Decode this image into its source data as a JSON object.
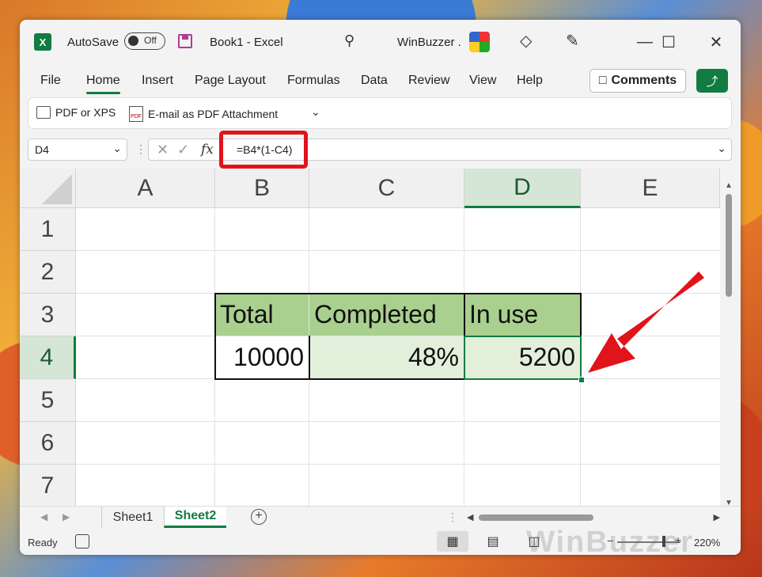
{
  "titlebar": {
    "autosave_label": "AutoSave",
    "autosave_state": "Off",
    "doc_title": "Book1  -  Excel",
    "account_name": "WinBuzzer ."
  },
  "menu": {
    "items": [
      "File",
      "Home",
      "Insert",
      "Page Layout",
      "Formulas",
      "Data",
      "Review",
      "View",
      "Help"
    ],
    "active": "Home",
    "comments_label": "Comments"
  },
  "ribbon": {
    "pdf_xps_label": "PDF or XPS",
    "email_pdf_label": "E-mail as PDF Attachment",
    "pdf_icon_text": "PDF"
  },
  "formula_bar": {
    "name_box": "D4",
    "fx_label": "fx",
    "formula": "=B4*(1-C4)"
  },
  "grid": {
    "columns": [
      "A",
      "B",
      "C",
      "D",
      "E"
    ],
    "rows": [
      "1",
      "2",
      "3",
      "4",
      "5",
      "6",
      "7"
    ],
    "selected_cell": "D4",
    "cells": {
      "B3": "Total",
      "C3": "Completed",
      "D3": "In use",
      "B4": "10000",
      "C4": "48%",
      "D4": "5200"
    }
  },
  "sheets": {
    "tabs": [
      "Sheet1",
      "Sheet2"
    ],
    "active": "Sheet2"
  },
  "status": {
    "ready": "Ready",
    "zoom": "220%",
    "watermark": "WinBuzzer"
  },
  "colors": {
    "accent": "#107c41",
    "header_fill": "#a9d08e",
    "value_fill": "#e2efda",
    "highlight": "#e0141b"
  }
}
